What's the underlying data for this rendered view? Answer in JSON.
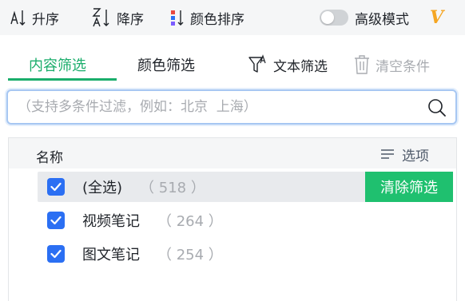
{
  "toolbar": {
    "sort_asc_label": "升序",
    "sort_desc_label": "降序",
    "color_sort_label": "颜色排序",
    "advanced_label": "高级模式",
    "advanced_enabled": false,
    "vip_badge": "V",
    "colors": {
      "accent": "#1aad6b",
      "vip": "#f5a623",
      "color_bar": [
        "#e9483f",
        "#2b6ff3",
        "#7b5cff"
      ]
    }
  },
  "tabs": [
    {
      "label": "内容筛选",
      "active": true
    },
    {
      "label": "颜色筛选",
      "active": false
    }
  ],
  "actions": {
    "text_filter_label": "文本筛选",
    "clear_conditions_label": "清空条件"
  },
  "search": {
    "value": "",
    "placeholder": "（支持多条件过滤，例如：北京  上海）"
  },
  "list": {
    "column_name": "名称",
    "options_label": "选项",
    "clear_filter_button": "清除筛选",
    "items": [
      {
        "label": "(全选)",
        "count": "（ 518 ）",
        "checked": true
      },
      {
        "label": "视频笔记",
        "count": "（ 264 ）",
        "checked": true
      },
      {
        "label": "图文笔记",
        "count": "（ 254 ）",
        "checked": true
      }
    ]
  }
}
